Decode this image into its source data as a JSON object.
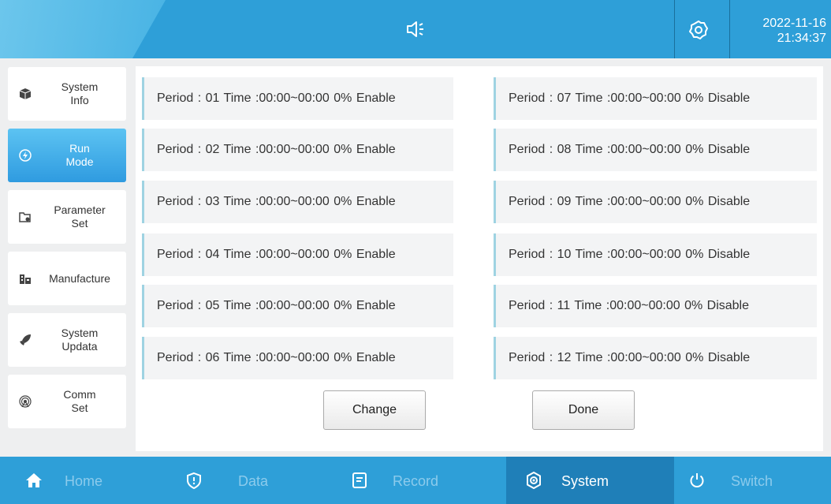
{
  "header": {
    "date": "2022-11-16",
    "time": "21:34:37"
  },
  "sidebar": {
    "items": [
      {
        "label": "System\nInfo",
        "icon": "cube-icon",
        "active": false
      },
      {
        "label": "Run\nMode",
        "icon": "bolt-icon",
        "active": true
      },
      {
        "label": "Parameter\nSet",
        "icon": "folder-gear-icon",
        "active": false
      },
      {
        "label": "Manufacture",
        "icon": "factory-icon",
        "active": false
      },
      {
        "label": "System\nUpdata",
        "icon": "rocket-icon",
        "active": false
      },
      {
        "label": "Comm\nSet",
        "icon": "signal-icon",
        "active": false
      }
    ]
  },
  "periods": {
    "left": [
      "Period : 01  Time :00:00~00:00  0%  Enable",
      "Period : 02  Time :00:00~00:00  0%  Enable",
      "Period : 03  Time :00:00~00:00  0%  Enable",
      "Period : 04  Time :00:00~00:00  0%  Enable",
      "Period : 05  Time :00:00~00:00  0%  Enable",
      "Period : 06  Time :00:00~00:00  0%  Enable"
    ],
    "right": [
      "Period : 07  Time :00:00~00:00  0%  Disable",
      "Period : 08  Time :00:00~00:00  0%  Disable",
      "Period : 09  Time :00:00~00:00  0%  Disable",
      "Period : 10  Time :00:00~00:00  0%  Disable",
      "Period : 11  Time :00:00~00:00  0%  Disable",
      "Period : 12  Time :00:00~00:00  0%  Disable"
    ]
  },
  "buttons": {
    "change": "Change",
    "done": "Done"
  },
  "footer": {
    "tabs": [
      {
        "label": "Home",
        "icon": "home-icon"
      },
      {
        "label": "Data",
        "icon": "shield-icon"
      },
      {
        "label": "Record",
        "icon": "document-icon"
      },
      {
        "label": "System",
        "icon": "system-gear-icon"
      },
      {
        "label": "Switch",
        "icon": "power-icon"
      }
    ]
  },
  "colors": {
    "header": "#2e9fd8",
    "active_sidebar": "#3aa9e6",
    "active_tab": "#1f7fb8"
  }
}
